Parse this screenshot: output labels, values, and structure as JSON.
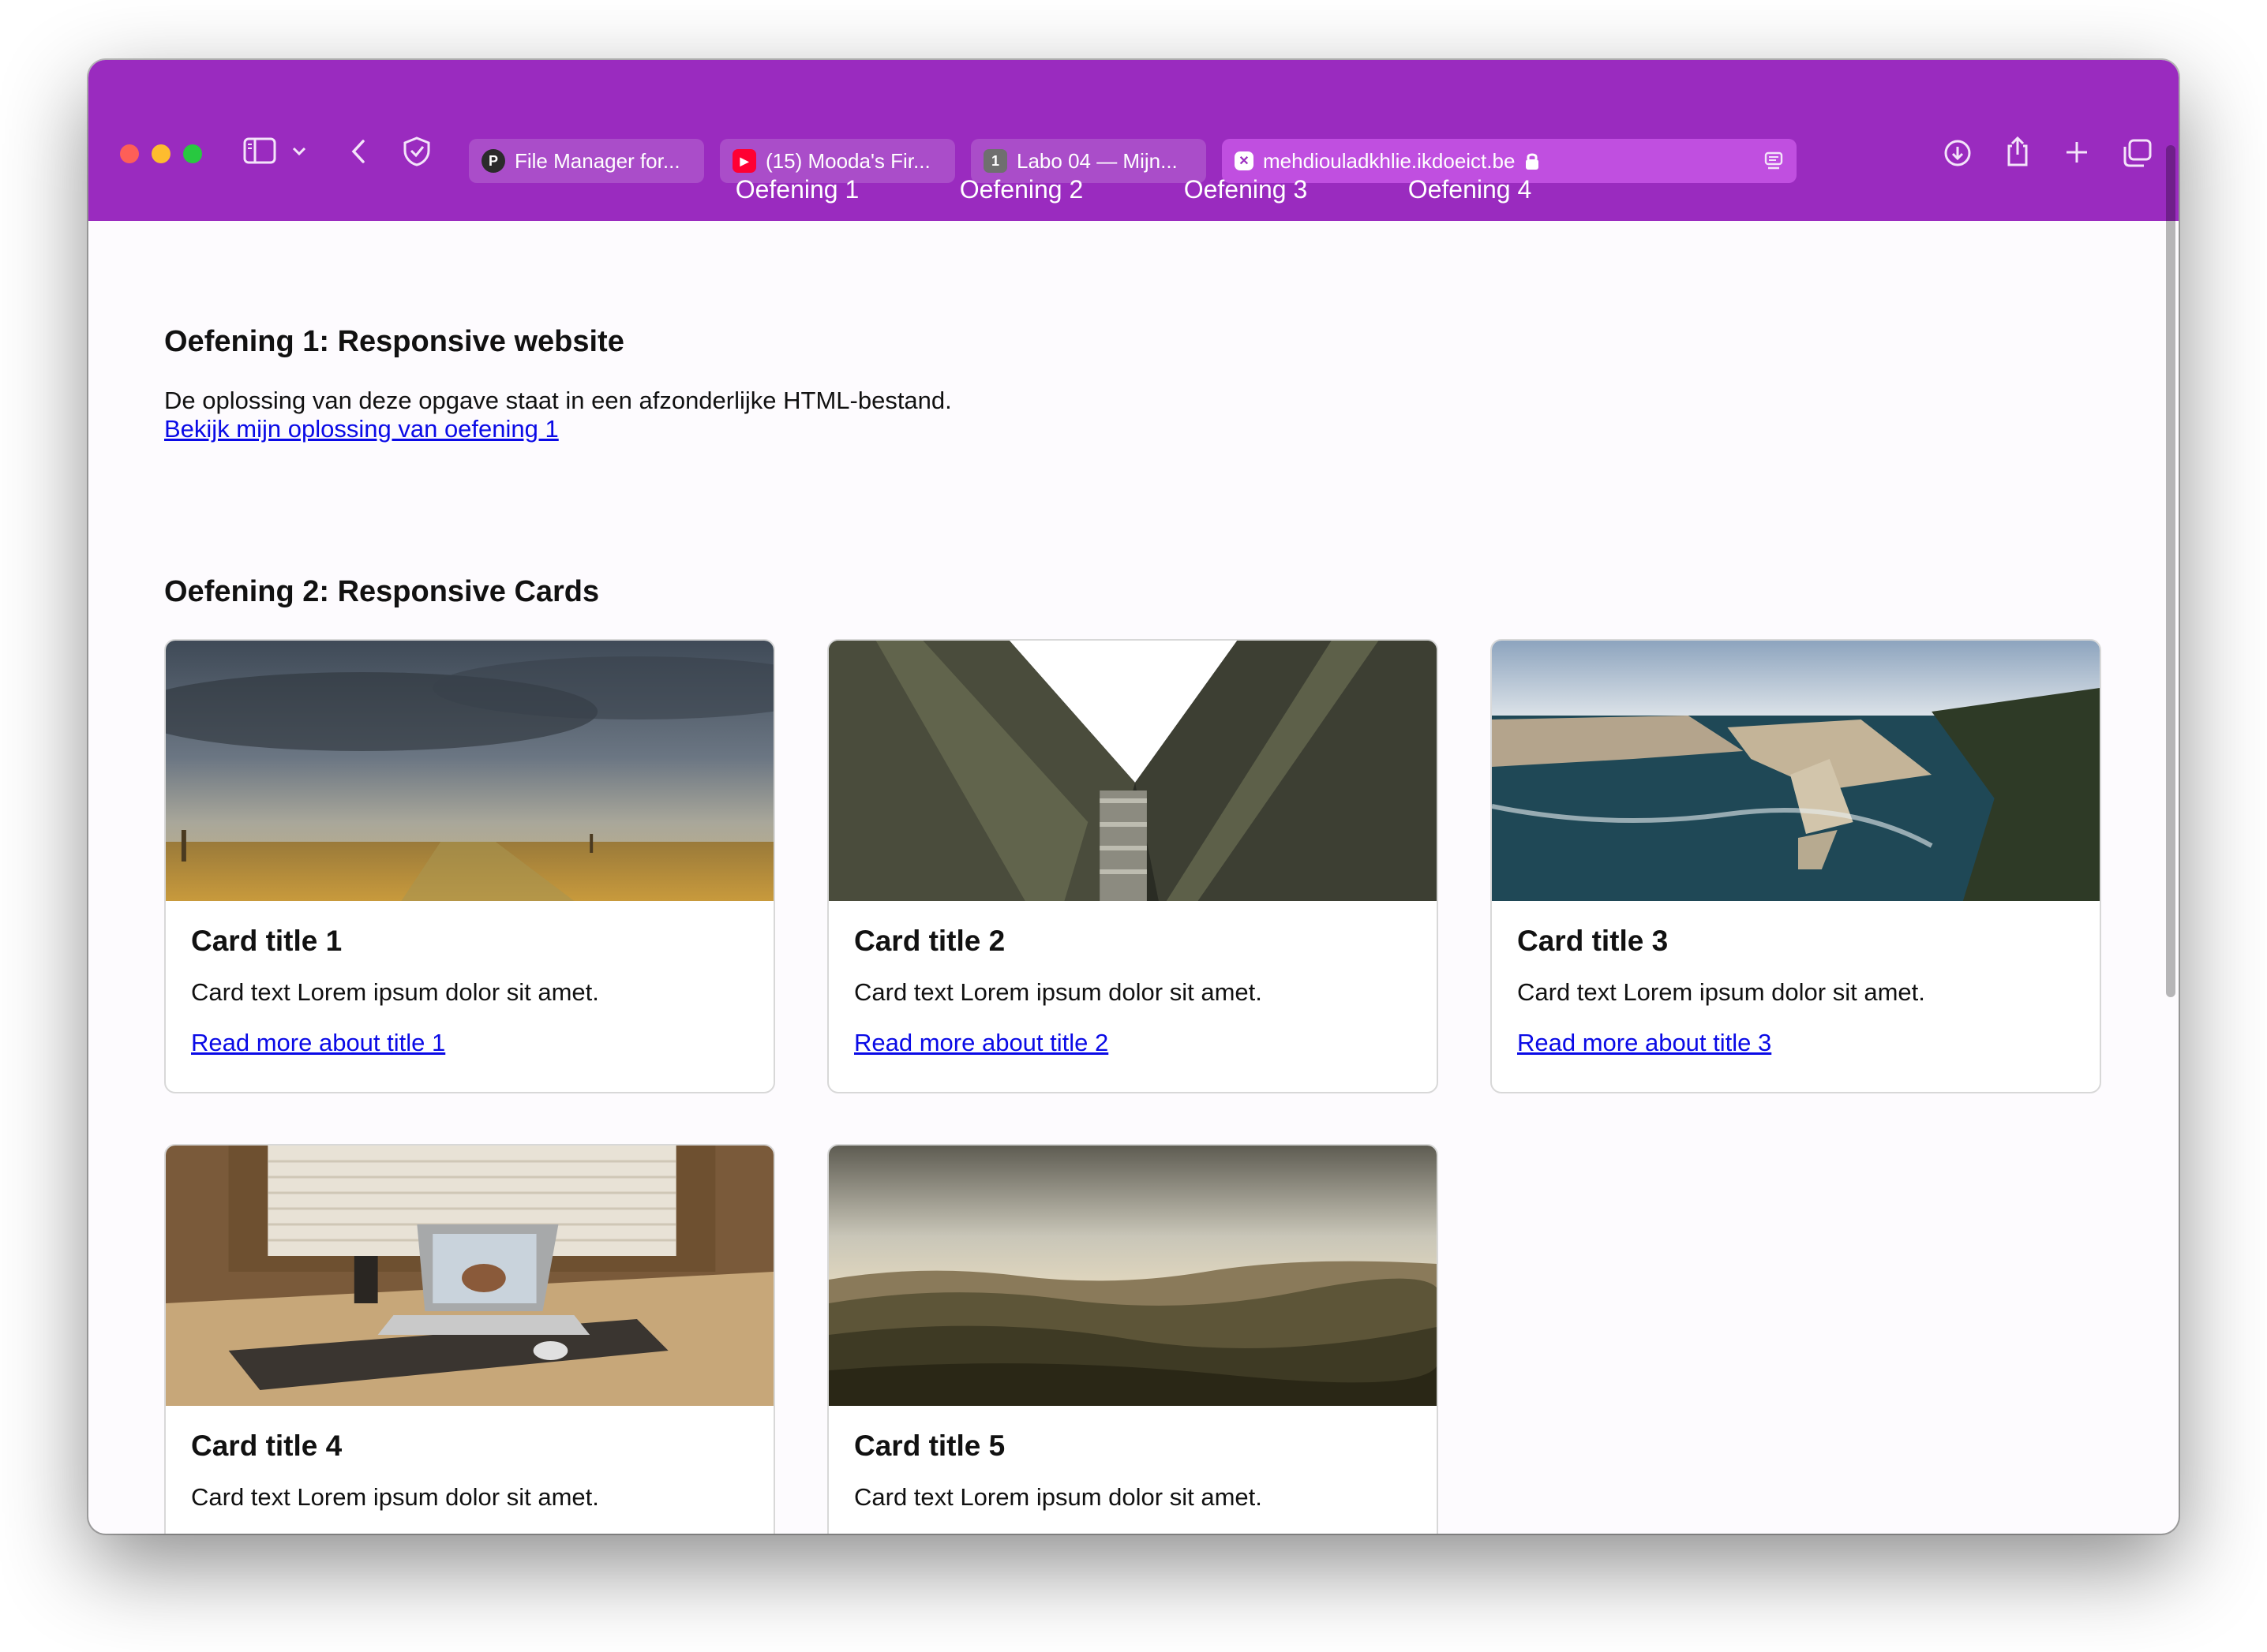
{
  "browser": {
    "tabs": [
      {
        "label": "File Manager for...",
        "favicon": "P",
        "favicon_color": "#2b2b2b",
        "active": false
      },
      {
        "label": "(15) Mooda's Fir...",
        "favicon": "▶",
        "favicon_color": "#ff0033",
        "active": false
      },
      {
        "label": "Labo 04 — Mijn...",
        "favicon": "1",
        "favicon_color": "#6f6f6f",
        "active": false
      },
      {
        "label": "mehdiouladkhlie.ikdoeict.be",
        "favicon": "✕",
        "favicon_color": "#e8c9f4",
        "active": true
      }
    ]
  },
  "nav": {
    "items": [
      "Oefening 1",
      "Oefening 2",
      "Oefening 3",
      "Oefening 4"
    ]
  },
  "section1": {
    "title": "Oefening 1: Responsive website",
    "text": "De oplossing van deze opgave staat in een afzonderlijke HTML-bestand.",
    "link": "Bekijk mijn oplossing van oefening 1"
  },
  "section2": {
    "title": "Oefening 2: Responsive Cards",
    "cards": [
      {
        "title": "Card title 1",
        "text": "Card text Lorem ipsum dolor sit amet.",
        "link": "Read more about title 1"
      },
      {
        "title": "Card title 2",
        "text": "Card text Lorem ipsum dolor sit amet.",
        "link": "Read more about title 2"
      },
      {
        "title": "Card title 3",
        "text": "Card text Lorem ipsum dolor sit amet.",
        "link": "Read more about title 3"
      },
      {
        "title": "Card title 4",
        "text": "Card text Lorem ipsum dolor sit amet.",
        "link": ""
      },
      {
        "title": "Card title 5",
        "text": "Card text Lorem ipsum dolor sit amet.",
        "link": ""
      }
    ]
  },
  "colors": {
    "chrome": "#9a2bbf",
    "active_tab": "#c04fe0",
    "link": "#0a0ae6"
  }
}
